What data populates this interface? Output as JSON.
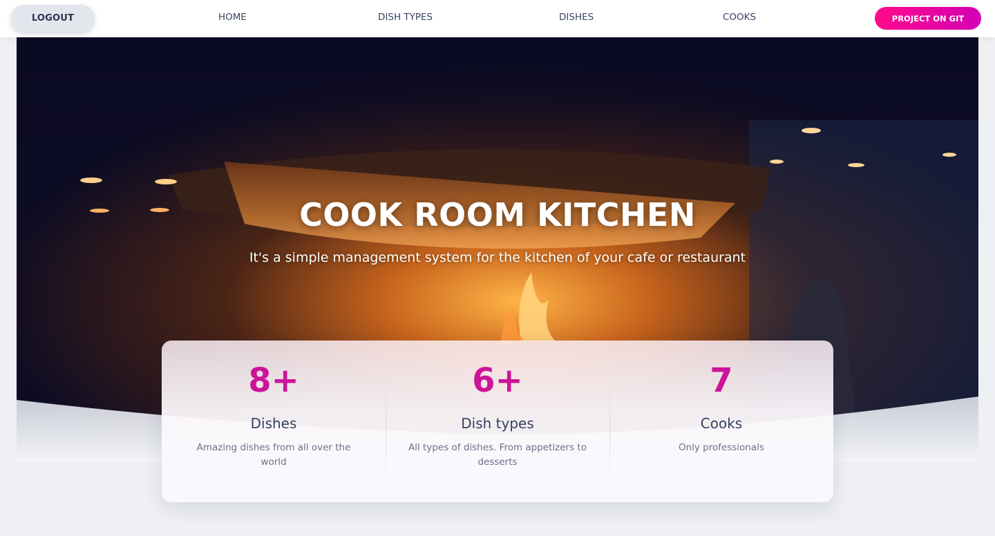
{
  "navbar": {
    "logout_label": "LOGOUT",
    "links": [
      {
        "label": "HOME"
      },
      {
        "label": "DISH TYPES"
      },
      {
        "label": "DISHES"
      },
      {
        "label": "COOKS"
      }
    ],
    "git_button_label": "PROJECT ON GIT"
  },
  "hero": {
    "title": "COOK ROOM KITCHEN",
    "subtitle": "It's a simple management system for the kitchen of your cafe or restaurant"
  },
  "stats": [
    {
      "value": "8+",
      "label": "Dishes",
      "description": "Amazing dishes from all over the world"
    },
    {
      "value": "6+",
      "label": "Dish types",
      "description": "All types of dishes. From appetizers to desserts"
    },
    {
      "value": "7",
      "label": "Cooks",
      "description": "Only professionals"
    }
  ],
  "colors": {
    "accent": "#cc1499",
    "git_gradient_start": "#ff0a8a",
    "git_gradient_end": "#d300b4",
    "nav_text": "#3a4564"
  }
}
